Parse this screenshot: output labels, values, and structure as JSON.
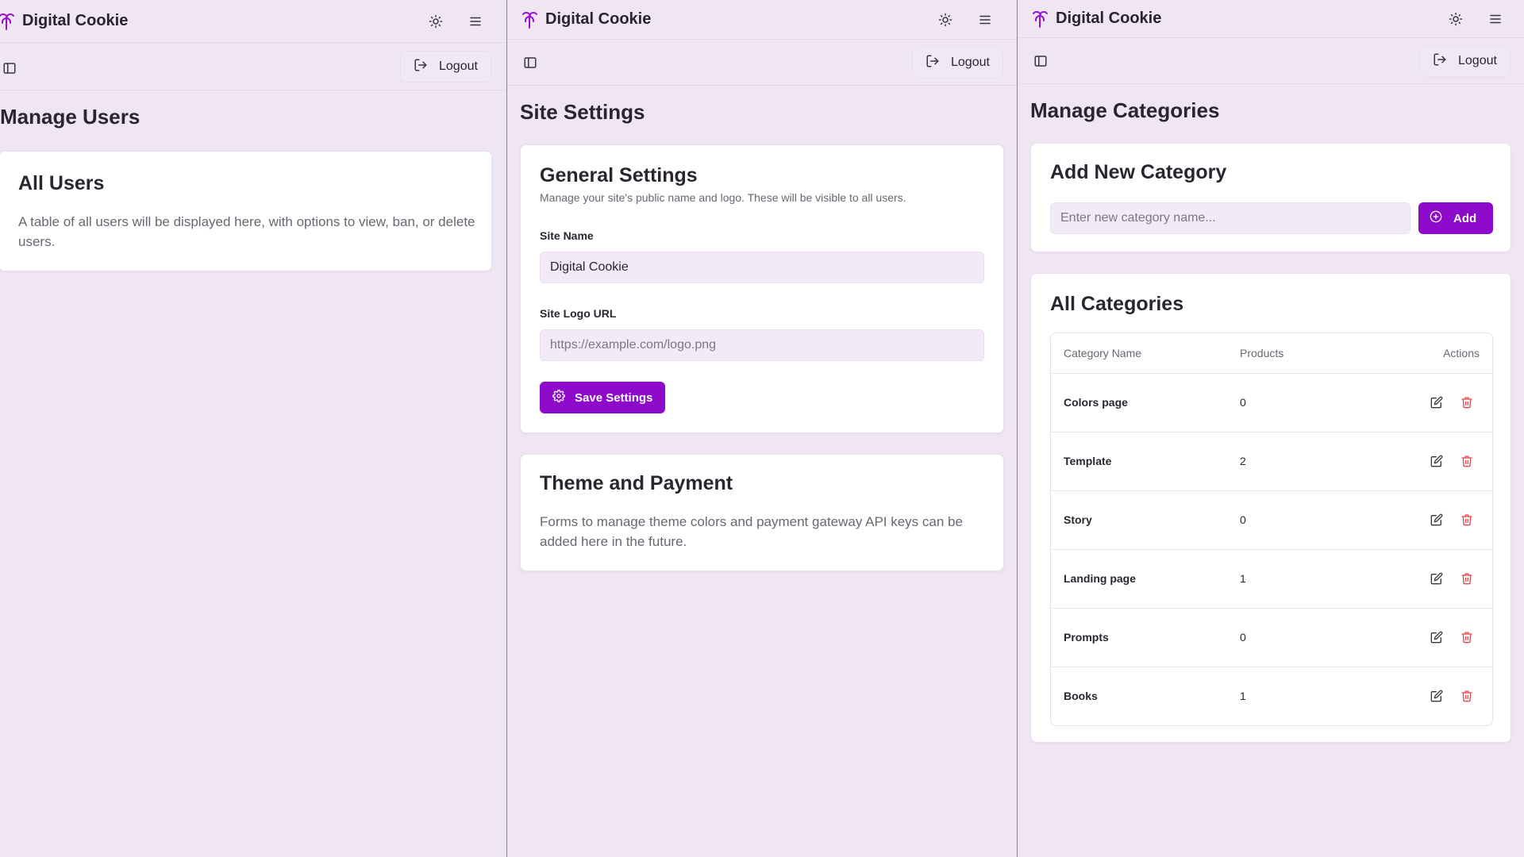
{
  "brand": {
    "name": "Digital Cookie",
    "accent": "#8e0acb",
    "logo_color": "#9a0fd0"
  },
  "header": {
    "theme_icon": "sun-icon",
    "menu_icon": "hamburger-menu-icon",
    "sidebar_icon": "sidebar-panel-icon",
    "logout_icon": "logout-icon",
    "logout_label": "Logout"
  },
  "users_page": {
    "title": "Manage Users",
    "card_title": "All Users",
    "card_text": "A table of all users will be displayed here, with options to view, ban, or delete users."
  },
  "settings_page": {
    "title": "Site Settings",
    "general": {
      "title": "General Settings",
      "description": "Manage your site's public name and logo. These will be visible to all users.",
      "site_name_label": "Site Name",
      "site_name_value": "Digital Cookie",
      "logo_url_label": "Site Logo URL",
      "logo_url_placeholder": "https://example.com/logo.png",
      "save_label": "Save Settings",
      "save_icon": "gear-icon"
    },
    "theme": {
      "title": "Theme and Payment",
      "text": "Forms to manage theme colors and payment gateway API keys can be added here in the future."
    }
  },
  "categories_page": {
    "title": "Manage Categories",
    "add_card": {
      "title": "Add New Category",
      "input_placeholder": "Enter new category name...",
      "add_label": "Add",
      "add_icon": "plus-circle-icon"
    },
    "list_card": {
      "title": "All Categories",
      "columns": [
        "Category Name",
        "Products",
        "Actions"
      ],
      "rows": [
        {
          "name": "Colors page",
          "products": "0"
        },
        {
          "name": "Template",
          "products": "2"
        },
        {
          "name": "Story",
          "products": "0"
        },
        {
          "name": "Landing page",
          "products": "1"
        },
        {
          "name": "Prompts",
          "products": "0"
        },
        {
          "name": "Books",
          "products": "1"
        }
      ],
      "edit_icon": "edit-icon",
      "delete_icon": "trash-icon",
      "delete_color": "#e0444f"
    }
  }
}
